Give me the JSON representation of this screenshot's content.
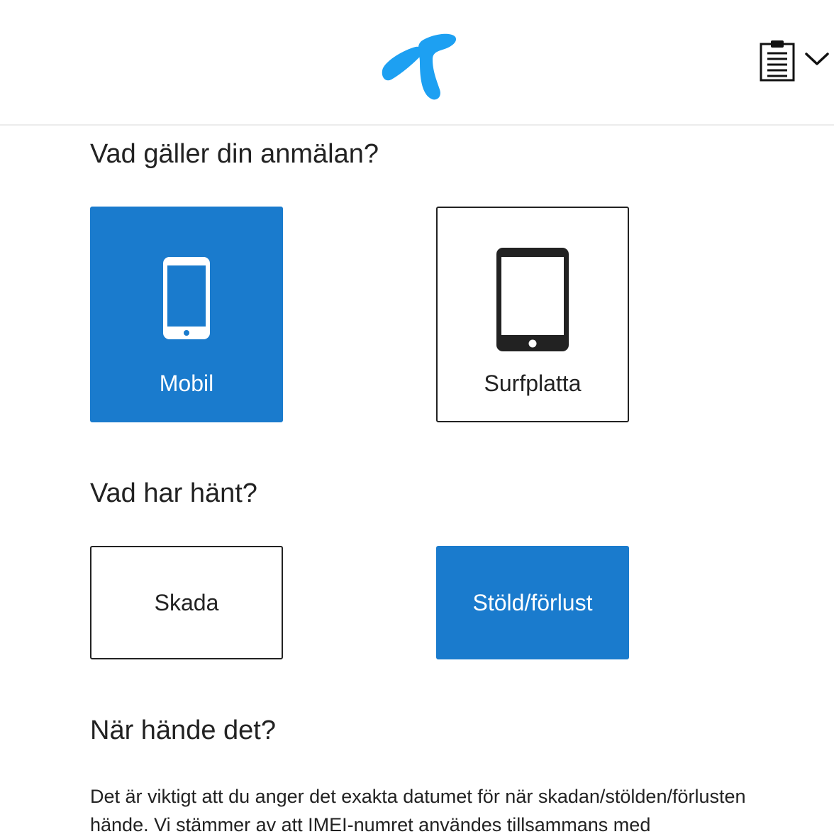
{
  "header": {
    "logo_icon": "telenor-logo-icon",
    "logo_color": "#1da0f2",
    "menu_icon": "clipboard-list-icon",
    "menu_chevron_icon": "chevron-down-icon"
  },
  "sections": {
    "device": {
      "heading": "Vad gäller din anmälan?",
      "options": [
        {
          "label": "Mobil",
          "icon": "smartphone-icon",
          "selected": true
        },
        {
          "label": "Surfplatta",
          "icon": "tablet-icon",
          "selected": false
        }
      ]
    },
    "incident": {
      "heading": "Vad har hänt?",
      "options": [
        {
          "label": "Skada",
          "selected": false
        },
        {
          "label": "Stöld/förlust",
          "selected": true
        }
      ]
    },
    "date": {
      "heading": "När hände det?",
      "description": "Det är viktigt att du anger det exakta datumet för när skadan/stölden/förlusten hände. Vi stämmer av att IMEI-numret användes tillsammans med"
    }
  },
  "colors": {
    "accent": "#1a7bcd",
    "text": "#222222"
  }
}
